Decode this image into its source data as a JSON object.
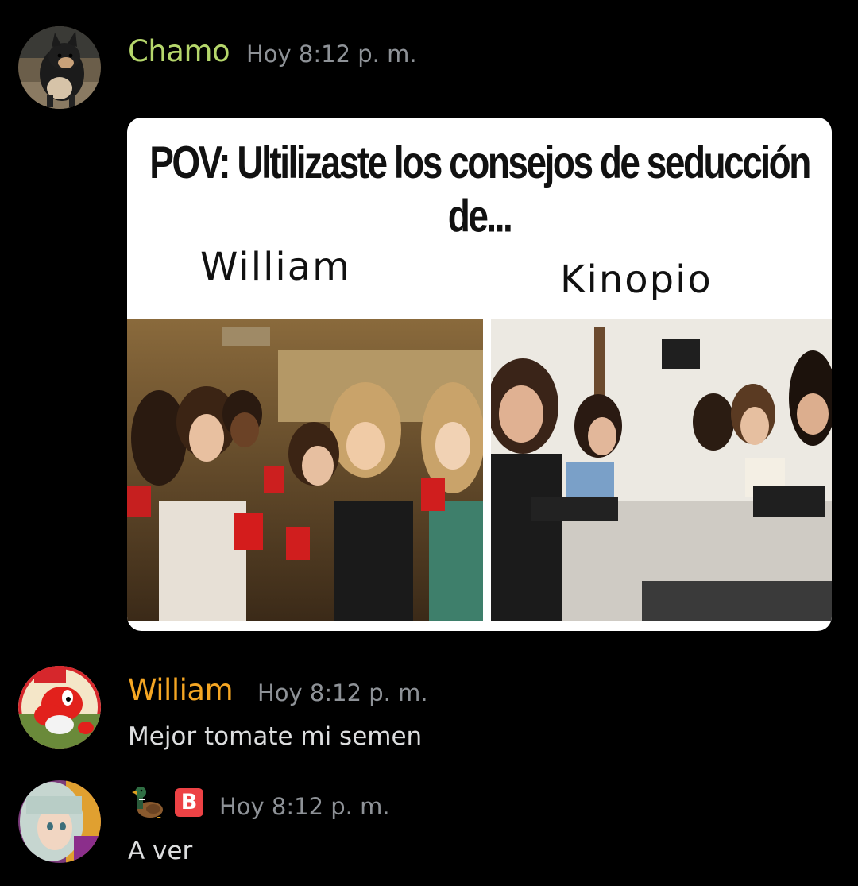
{
  "messages": [
    {
      "author": "Chamo",
      "author_color": "#b5d66b",
      "timestamp": "Hoy 8:12 p. m.",
      "avatar": "dog-avatar",
      "meme": {
        "title": "POV: Ultilizaste los consejos de seducción de...",
        "left_label": "William",
        "right_label": "Kinopio"
      }
    },
    {
      "author": "William",
      "author_color": "#f5a623",
      "timestamp": "Hoy 8:12 p. m.",
      "avatar": "yoshi-avatar",
      "content": "Mejor tomate mi semen"
    },
    {
      "author_icon": "duck-icon",
      "author_badge": "B",
      "timestamp": "Hoy 8:12 p. m.",
      "avatar": "anime-avatar",
      "content": "A ver"
    }
  ]
}
